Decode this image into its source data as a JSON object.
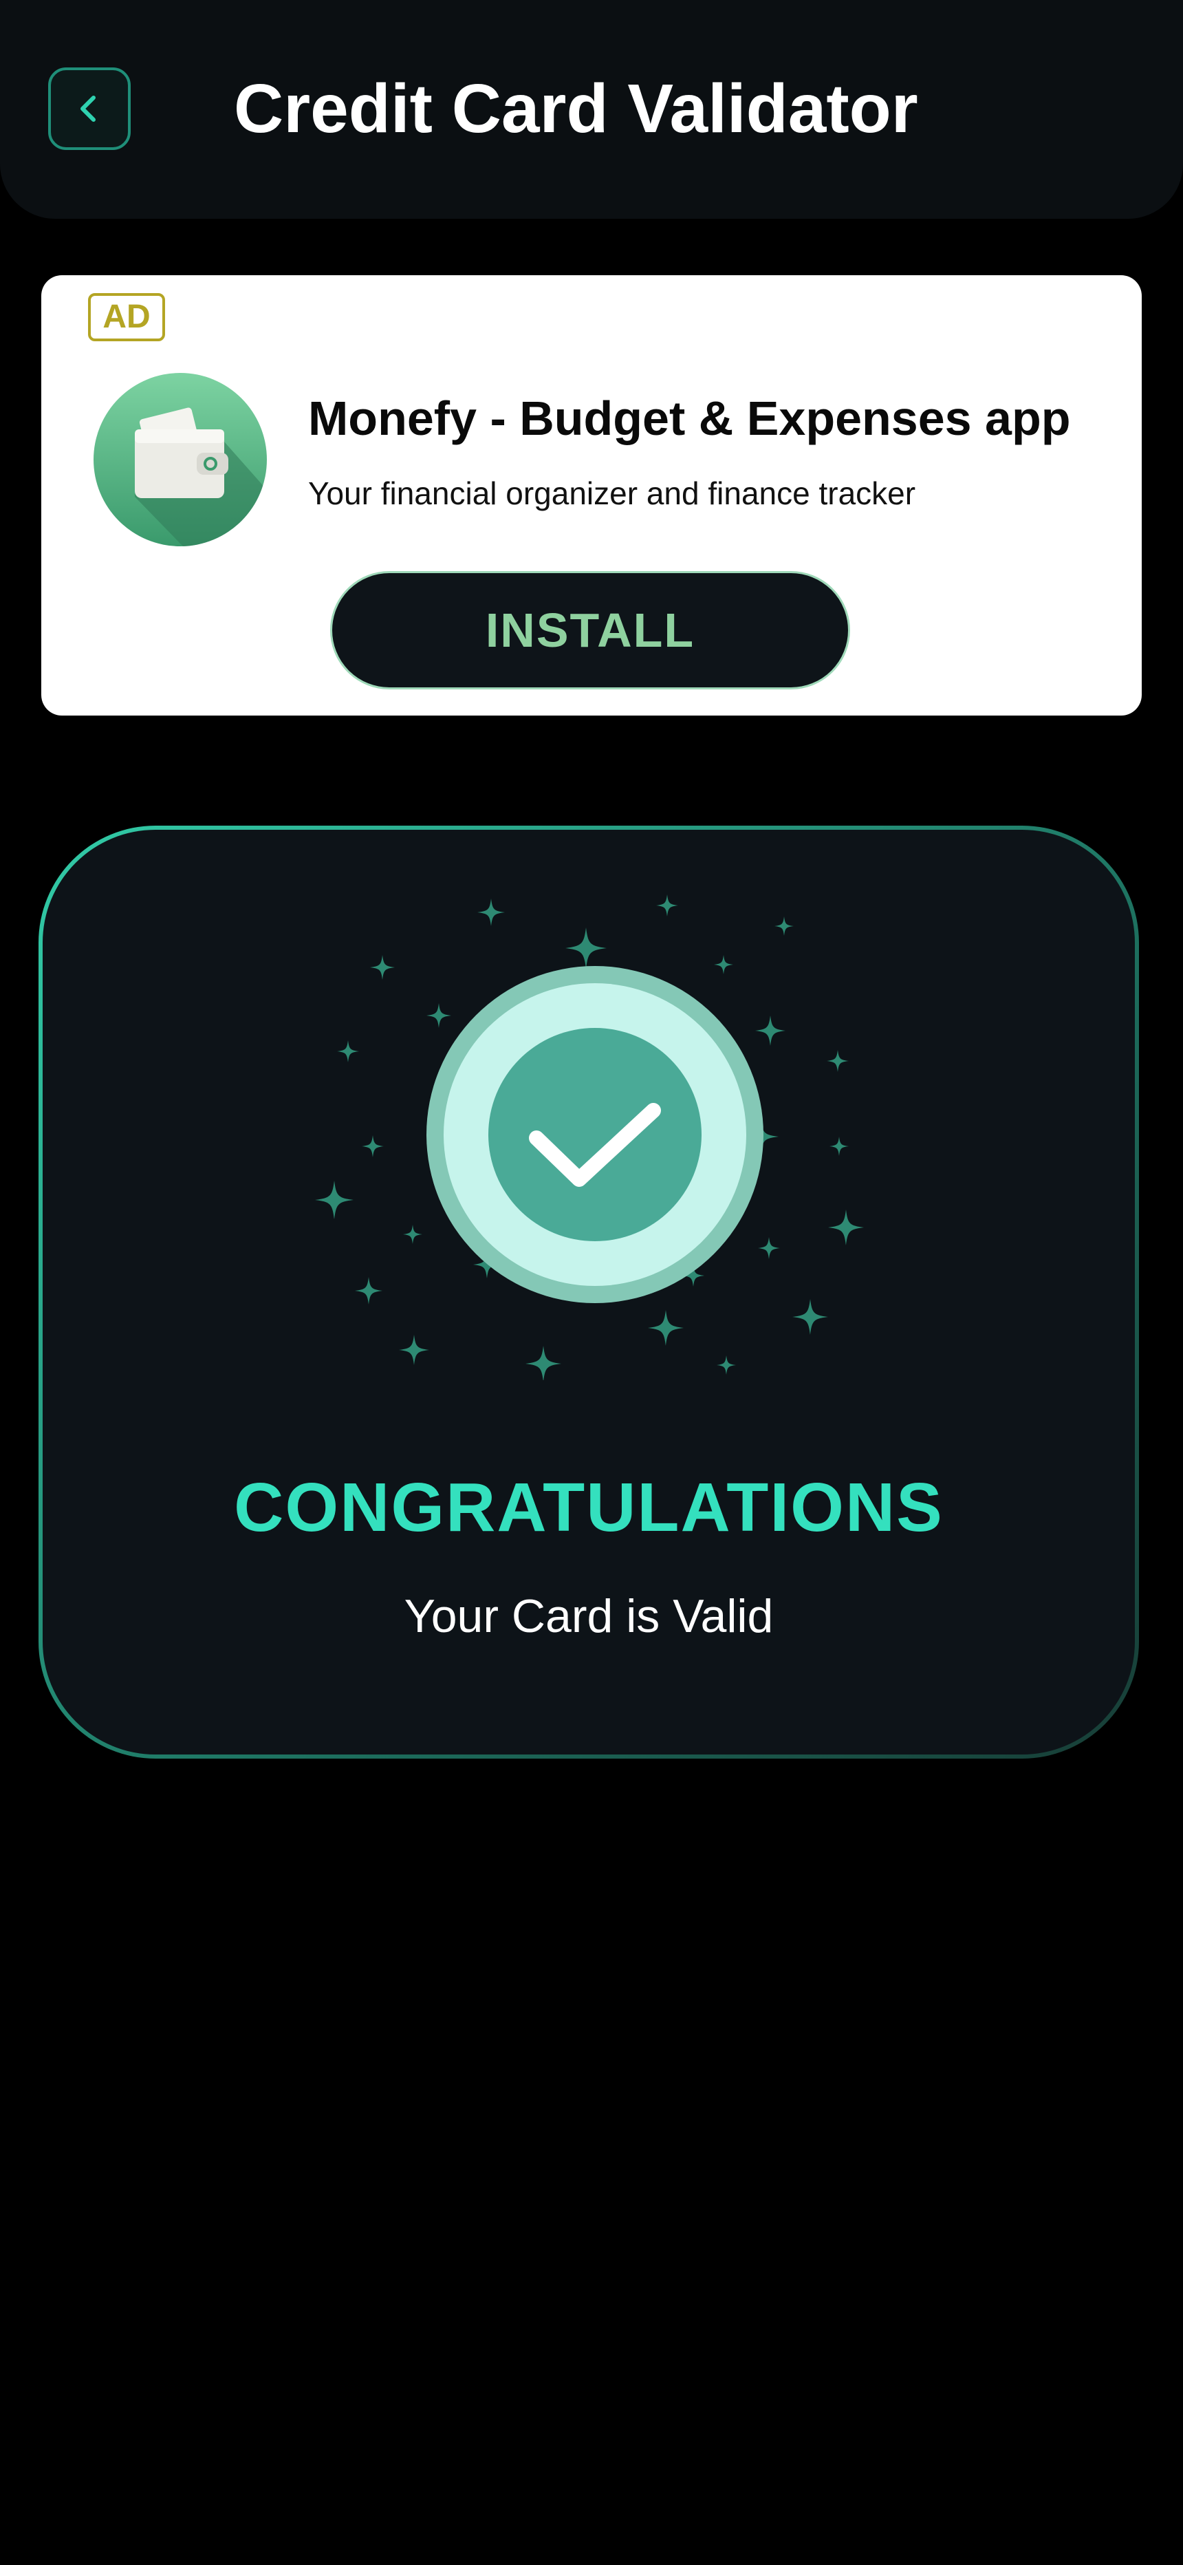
{
  "header": {
    "title": "Credit Card Validator",
    "back_icon": "chevron-left-icon"
  },
  "ad": {
    "badge": "AD",
    "app_icon": "wallet-icon",
    "app_name": "Monefy - Budget & Expenses app",
    "description": "Your financial organizer and finance tracker",
    "install_label": "INSTALL"
  },
  "result": {
    "icon": "check-icon",
    "headline": "CONGRATULATIONS",
    "message": "Your Card is Valid"
  },
  "colors": {
    "accent": "#34e0be",
    "header_bg": "#0b0f12",
    "card_bg": "#0d1318",
    "ad_badge": "#b4a524",
    "install_text": "#8fd19f",
    "check_inner": "#4aaa97",
    "check_ring": "#c6f4ec"
  }
}
